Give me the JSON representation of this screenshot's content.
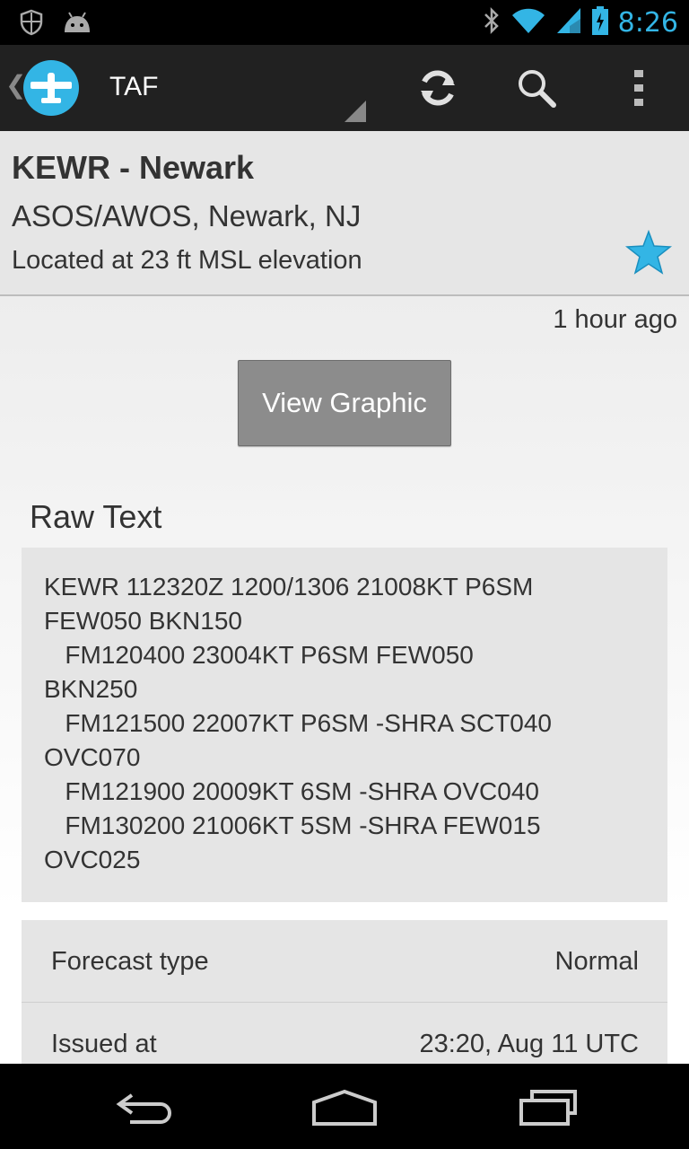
{
  "status_bar": {
    "time": "8:26",
    "icons": [
      "shield-icon",
      "android-icon",
      "bluetooth-icon",
      "wifi-icon",
      "signal-icon",
      "battery-icon"
    ]
  },
  "action_bar": {
    "title": "TAF",
    "actions": [
      "refresh-icon",
      "search-icon",
      "overflow-menu-icon"
    ]
  },
  "station": {
    "name": "KEWR - Newark",
    "type_location": "ASOS/AWOS, Newark, NJ",
    "elevation": "Located at 23 ft MSL elevation"
  },
  "report": {
    "age": "1 hour ago",
    "view_graphic_label": "View Graphic",
    "raw_heading": "Raw Text",
    "raw_lines": [
      "KEWR 112320Z 1200/1306 21008KT P6SM",
      "FEW050 BKN150",
      "   FM120400 23004KT P6SM FEW050",
      "BKN250",
      "   FM121500 22007KT P6SM -SHRA SCT040",
      "OVC070",
      "   FM121900 20009KT 6SM -SHRA OVC040",
      "   FM130200 21006KT 5SM -SHRA FEW015",
      "OVC025"
    ]
  },
  "details": [
    {
      "label": "Forecast type",
      "value": "Normal"
    },
    {
      "label": "Issued at",
      "value": "23:20, Aug 11 UTC"
    }
  ],
  "colors": {
    "accent": "#33b5e5",
    "action_bar": "#212121",
    "header_bg": "#e6e6e6",
    "button_bg": "#8c8c8c"
  }
}
